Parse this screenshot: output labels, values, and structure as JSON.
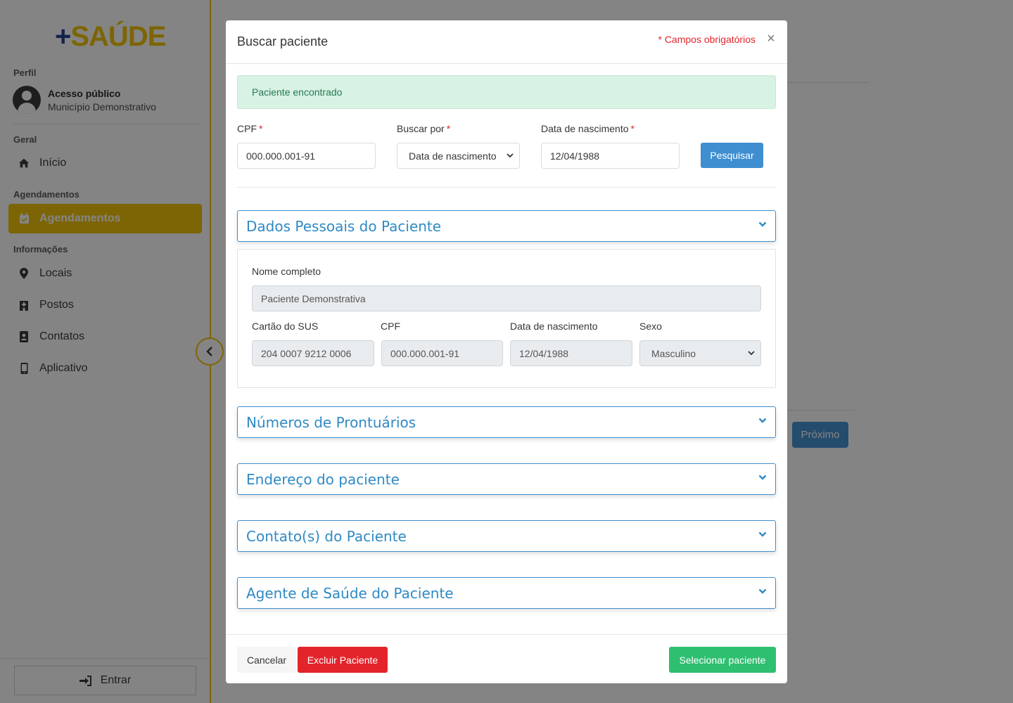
{
  "app": {
    "logo_plus": "+",
    "logo_word": "SAÚDE"
  },
  "sidebar": {
    "profile_section": "Perfil",
    "profile_name": "Acesso público",
    "profile_sub": "Município Demonstrativo",
    "geral_section": "Geral",
    "inicio": "Início",
    "agend_section": "Agendamentos",
    "agendamentos": "Agendamentos",
    "info_section": "Informações",
    "locais": "Locais",
    "postos": "Postos",
    "contatos": "Contatos",
    "aplicativo": "Aplicativo",
    "login": "Entrar",
    "accent_color": "#f0c000"
  },
  "background": {
    "next_button": "Próximo"
  },
  "modal": {
    "title": "Buscar paciente",
    "required_note": "* Campos obrigatórios",
    "close": "×",
    "alert": "Paciente encontrado",
    "search": {
      "cpf_label": "CPF",
      "cpf_value": "000.000.001-91",
      "buscar_label": "Buscar por",
      "buscar_value": "Data de nascimento",
      "dob_label": "Data de nascimento",
      "dob_value": "12/04/1988",
      "required_mark": "*",
      "search_button": "Pesquisar"
    },
    "sections": {
      "personal": "Dados Pessoais do Paciente",
      "records": "Números de Prontuários",
      "address": "Endereço do paciente",
      "contacts": "Contato(s) do Paciente",
      "agent": "Agente de Saúde do Paciente"
    },
    "personal": {
      "name_label": "Nome completo",
      "name_value": "Paciente Demonstrativa",
      "sus_label": "Cartão do SUS",
      "sus_value": "204 0007 9212 0006",
      "cpf_label": "CPF",
      "cpf_value": "000.000.001-91",
      "dob_label": "Data de nascimento",
      "dob_value": "12/04/1988",
      "sex_label": "Sexo",
      "sex_value": "Masculino"
    },
    "footer": {
      "cancel": "Cancelar",
      "delete": "Excluir Paciente",
      "select": "Selecionar paciente"
    }
  }
}
